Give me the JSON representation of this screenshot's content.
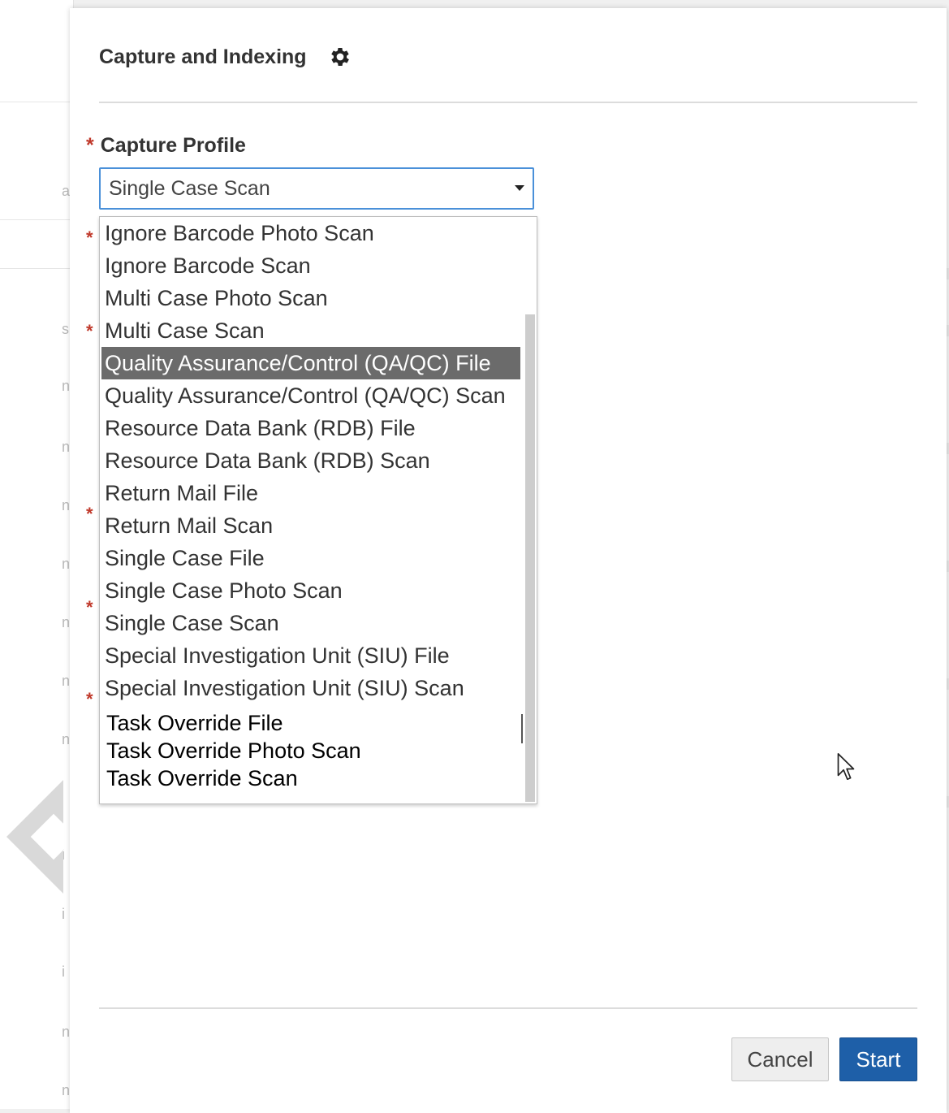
{
  "dialog": {
    "title": "Capture and Indexing",
    "settings_icon": "gear-icon"
  },
  "capture_profile": {
    "label": "Capture Profile",
    "required_marker": "*",
    "selected_value": "Single Case Scan",
    "options": [
      "Ignore Barcode Photo Scan",
      "Ignore Barcode Scan",
      "Multi Case Photo Scan",
      "Multi Case Scan",
      "Quality Assurance/Control (QA/QC) File",
      "Quality Assurance/Control (QA/QC) Scan",
      "Resource Data Bank (RDB) File",
      "Resource Data Bank (RDB) Scan",
      "Return Mail File",
      "Return Mail Scan",
      "Single Case File",
      "Single Case Photo Scan",
      "Single Case Scan",
      "Special Investigation Unit (SIU) File",
      "Special Investigation Unit (SIU) Scan",
      "Task Override File",
      "Task Override Photo Scan",
      "Task Override Scan"
    ],
    "highlighted_option": "Quality Assurance/Control (QA/QC) File"
  },
  "other_required_markers": [
    "*",
    "*",
    "*",
    "*",
    "*"
  ],
  "footer": {
    "cancel_label": "Cancel",
    "start_label": "Start"
  },
  "colors": {
    "primary_button": "#1e5fa8",
    "focus_border": "#4a90d9",
    "required": "#c0392b",
    "highlight": "#6b6b6b"
  }
}
